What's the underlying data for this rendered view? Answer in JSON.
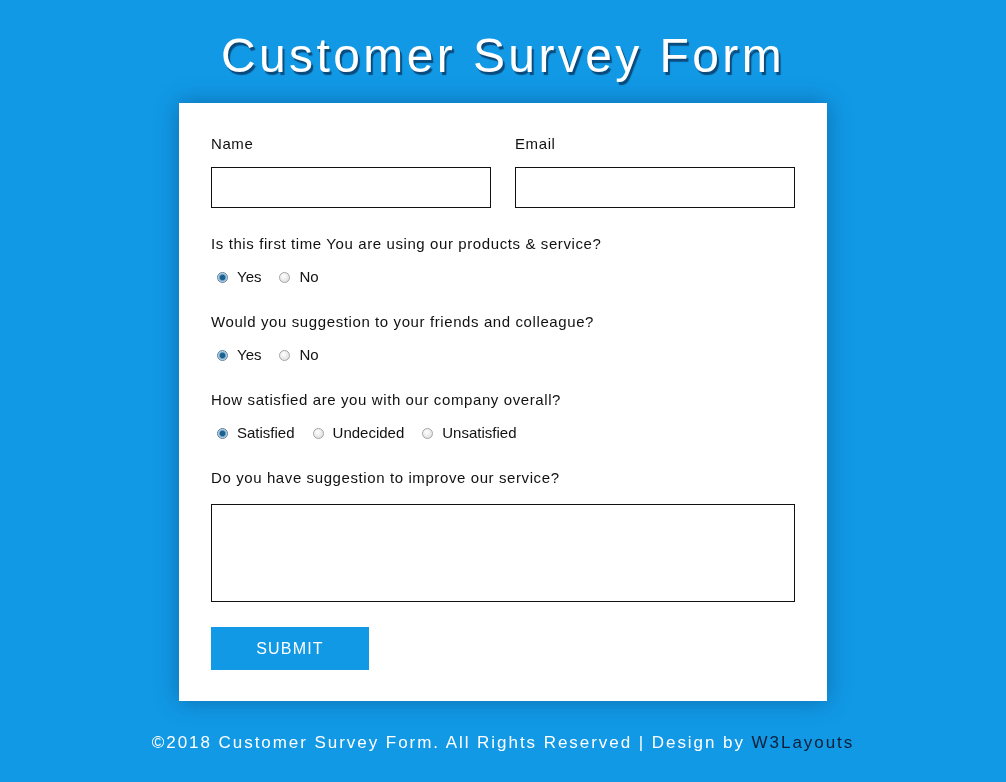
{
  "title": "Customer Survey Form",
  "fields": [
    {
      "label": "Name"
    },
    {
      "label": "Email"
    }
  ],
  "questions": [
    {
      "label": "Is this first time You are using our products & service?",
      "options": [
        {
          "label": "Yes",
          "selected": true
        },
        {
          "label": "No",
          "selected": false
        }
      ]
    },
    {
      "label": "Would you suggestion to your friends and colleague?",
      "options": [
        {
          "label": "Yes",
          "selected": true
        },
        {
          "label": "No",
          "selected": false
        }
      ]
    },
    {
      "label": "How satisfied are you with our company overall?",
      "options": [
        {
          "label": "Satisfied",
          "selected": true
        },
        {
          "label": "Undecided",
          "selected": false
        },
        {
          "label": "Unsatisfied",
          "selected": false
        }
      ]
    }
  ],
  "suggestion": {
    "label": "Do you have suggestion to improve our service?"
  },
  "submit": "SUBMIT",
  "footer": {
    "text": "©2018 Customer Survey Form. All Rights Reserved | Design by",
    "link": "W3Layouts"
  }
}
